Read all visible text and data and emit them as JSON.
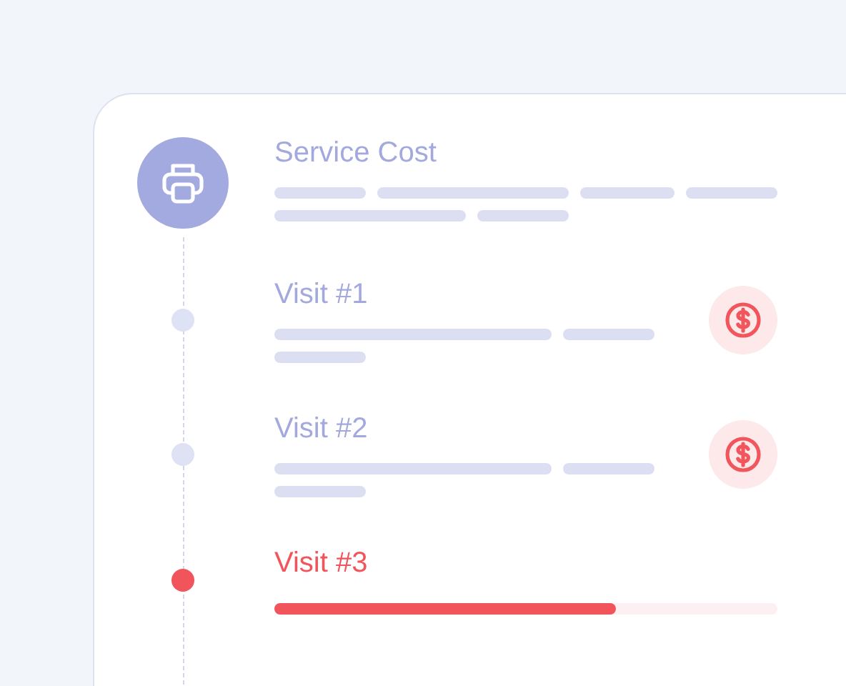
{
  "timeline": [
    {
      "kind": "header",
      "title": "Service Cost"
    },
    {
      "kind": "paid",
      "title": "Visit #1"
    },
    {
      "kind": "paid",
      "title": "Visit #2"
    },
    {
      "kind": "current",
      "title": "Visit #3",
      "level": 0.68
    }
  ]
}
